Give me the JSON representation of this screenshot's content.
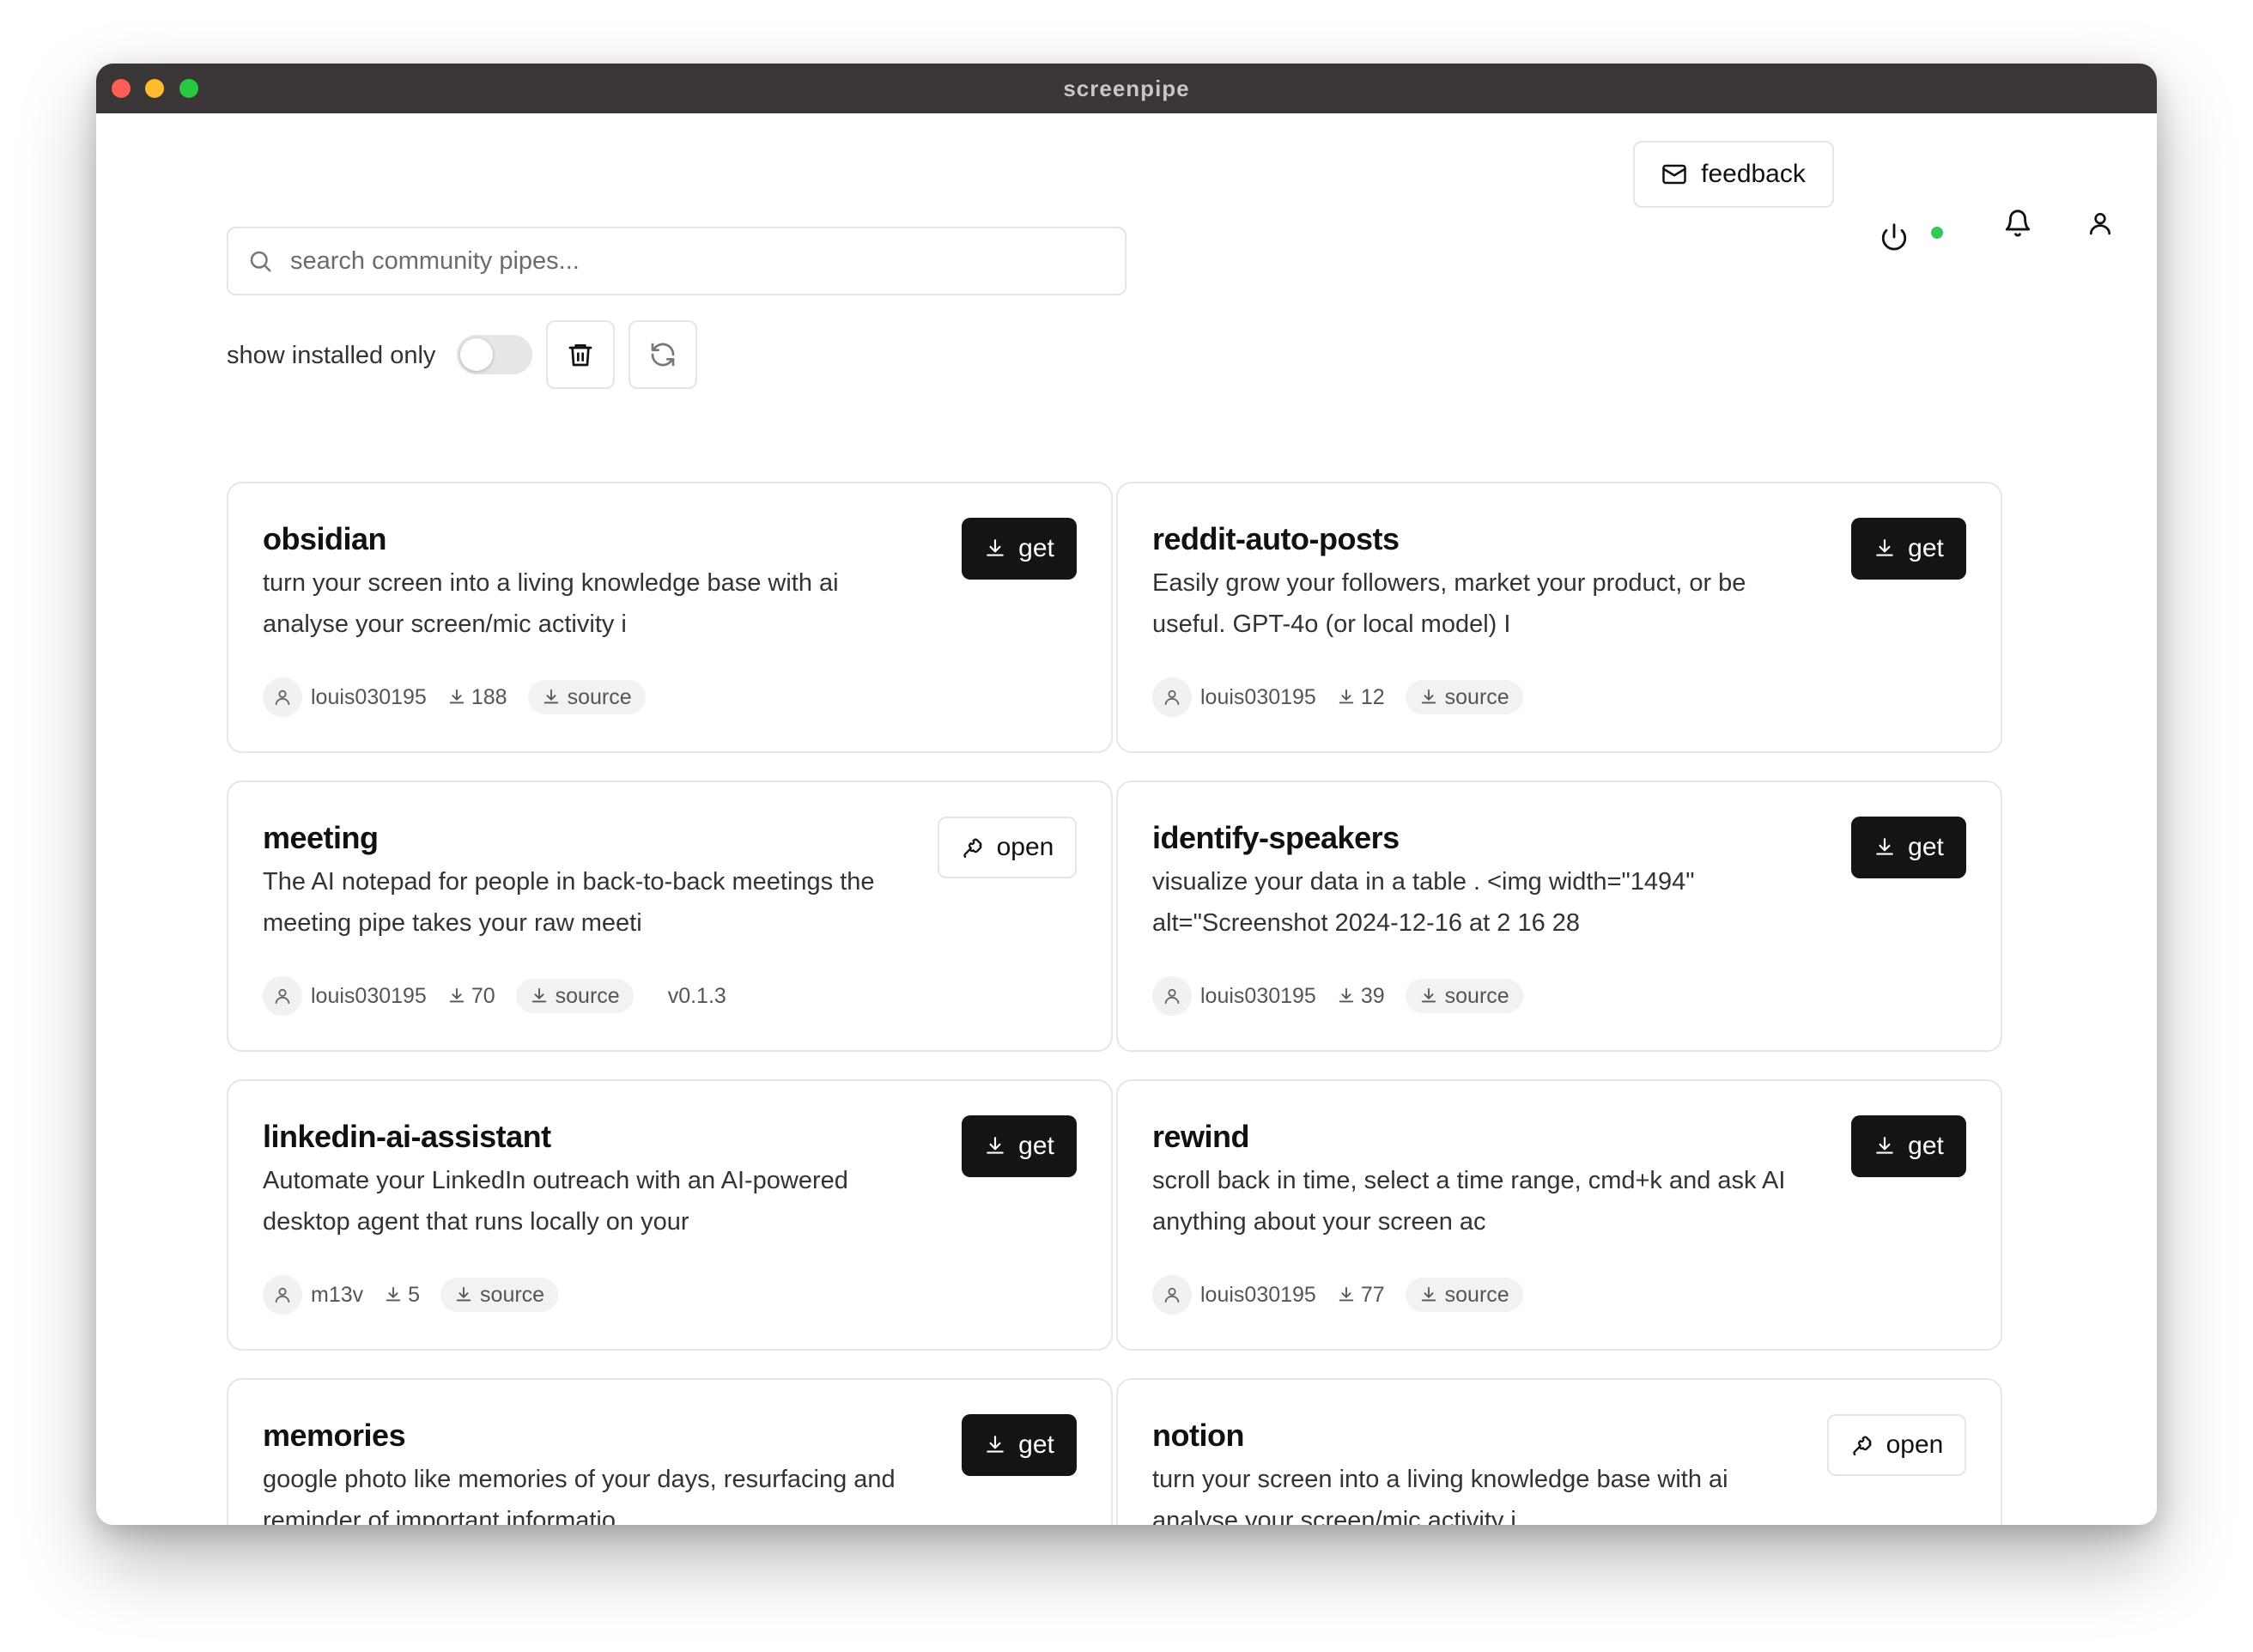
{
  "window": {
    "title": "screenpipe"
  },
  "header": {
    "feedback_label": "feedback"
  },
  "search": {
    "placeholder": "search community pipes..."
  },
  "filters": {
    "show_installed_label": "show installed only",
    "show_installed": false
  },
  "pipes": [
    {
      "name": "obsidian",
      "desc_line1": "turn your screen into a living knowledge base with ai",
      "desc_line2": "analyse your screen/mic activity i",
      "author": "louis030195",
      "downloads": "188",
      "source_label": "source",
      "version": "",
      "action": "get"
    },
    {
      "name": "reddit-auto-posts",
      "desc_line1": "Easily grow your followers, market your product, or be",
      "desc_line2": "useful. GPT-4o (or local model) I",
      "author": "louis030195",
      "downloads": "12",
      "source_label": "source",
      "version": "",
      "action": "get"
    },
    {
      "name": "meeting",
      "desc_line1": "The AI notepad for people in back-to-back meetings the",
      "desc_line2": "meeting pipe takes your raw meeti",
      "author": "louis030195",
      "downloads": "70",
      "source_label": "source",
      "version": "v0.1.3",
      "action": "open"
    },
    {
      "name": "identify-speakers",
      "desc_line1": "visualize your data in a table . <img width=\"1494\"",
      "desc_line2": "alt=\"Screenshot 2024-12-16 at 2 16 28",
      "author": "louis030195",
      "downloads": "39",
      "source_label": "source",
      "version": "",
      "action": "get"
    },
    {
      "name": "linkedin-ai-assistant",
      "desc_line1": "Automate your LinkedIn outreach with an AI-powered",
      "desc_line2": "desktop agent that runs locally on your",
      "author": "m13v",
      "downloads": "5",
      "source_label": "source",
      "version": "",
      "action": "get"
    },
    {
      "name": "rewind",
      "desc_line1": "scroll back in time, select a time range, cmd+k and ask AI",
      "desc_line2": "anything about your screen ac",
      "author": "louis030195",
      "downloads": "77",
      "source_label": "source",
      "version": "",
      "action": "get"
    },
    {
      "name": "memories",
      "desc_line1": "google photo like memories of your days, resurfacing and",
      "desc_line2": "reminder of important informatio",
      "author": "",
      "downloads": "",
      "source_label": "",
      "version": "",
      "action": "get"
    },
    {
      "name": "notion",
      "desc_line1": "turn your screen into a living knowledge base with ai",
      "desc_line2": "analyse your screen/mic activity i",
      "author": "",
      "downloads": "",
      "source_label": "",
      "version": "",
      "action": "open"
    }
  ],
  "labels": {
    "get": "get",
    "open": "open"
  },
  "colors": {
    "status_online": "#34c759",
    "primary_button": "#141414"
  }
}
